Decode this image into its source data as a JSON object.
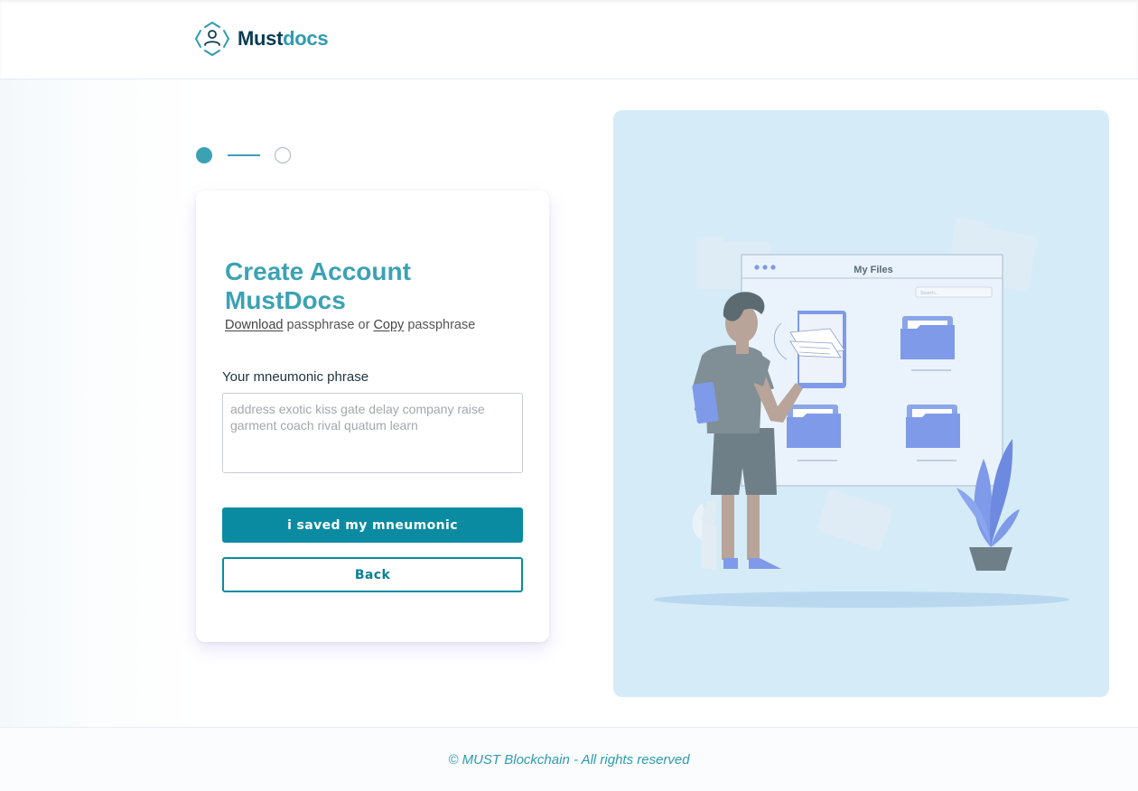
{
  "brand": {
    "name_part1": "Must",
    "name_part2": "docs",
    "accent_color": "#2d9bb0",
    "dark_color": "#0b3b53"
  },
  "stepper": {
    "current_step": 1,
    "total_steps": 2
  },
  "card": {
    "title": "Create Account MustDocs",
    "subtitle_link_download": "Download",
    "subtitle_text_1": " passphrase or ",
    "subtitle_link_copy": "Copy",
    "subtitle_text_2": " passphrase",
    "field_label": "Your mneumonic phrase",
    "phrase_placeholder": "address exotic kiss gate delay company raise garment coach rival quatum learn",
    "primary_button": "i saved my mneumonic",
    "secondary_button": "Back"
  },
  "illustration": {
    "window_title": "My  Files",
    "search_placeholder": "Search...",
    "background_color": "#d5ebf8"
  },
  "footer": {
    "copyright": "© MUST Blockchain - All rights reserved"
  }
}
